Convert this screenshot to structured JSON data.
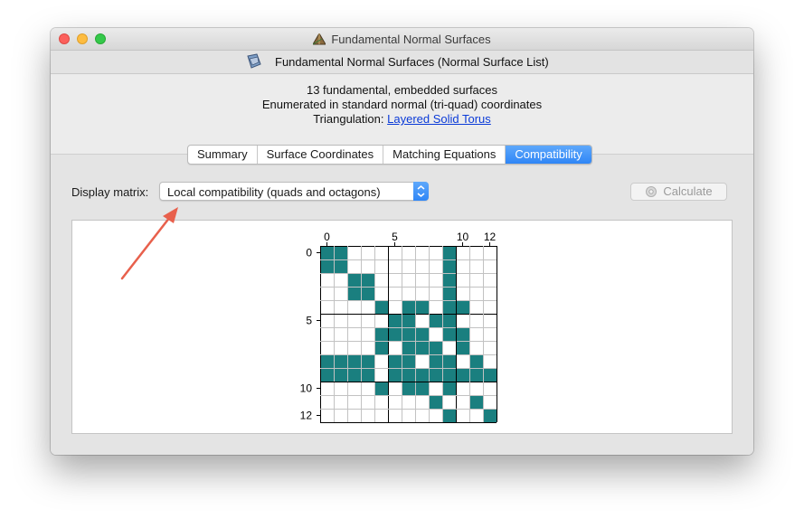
{
  "window": {
    "title": "Fundamental Normal Surfaces",
    "subtitle": "Fundamental Normal Surfaces (Normal Surface List)"
  },
  "info": {
    "line1": "13 fundamental, embedded surfaces",
    "line2": "Enumerated in standard normal (tri-quad) coordinates",
    "triangulation_prefix": "Triangulation:",
    "triangulation_link": "Layered Solid Torus"
  },
  "tabs": [
    {
      "label": "Summary",
      "active": false
    },
    {
      "label": "Surface Coordinates",
      "active": false
    },
    {
      "label": "Matching Equations",
      "active": false
    },
    {
      "label": "Compatibility",
      "active": true
    }
  ],
  "controls": {
    "display_label": "Display matrix:",
    "display_value": "Local compatibility (quads and octagons)",
    "calculate_label": "Calculate"
  },
  "matrix": {
    "size": 13,
    "fill_color": "#1a7f7f",
    "col_labels": [
      "0",
      "5",
      "10",
      "12"
    ],
    "row_labels": [
      "0",
      "5",
      "10",
      "12"
    ],
    "label_indices": [
      0,
      5,
      10,
      12
    ],
    "filled": [
      [
        0,
        0
      ],
      [
        0,
        1
      ],
      [
        0,
        9
      ],
      [
        1,
        0
      ],
      [
        1,
        1
      ],
      [
        1,
        9
      ],
      [
        2,
        2
      ],
      [
        2,
        3
      ],
      [
        2,
        9
      ],
      [
        3,
        2
      ],
      [
        3,
        3
      ],
      [
        3,
        9
      ],
      [
        4,
        4
      ],
      [
        4,
        6
      ],
      [
        4,
        7
      ],
      [
        4,
        9
      ],
      [
        4,
        10
      ],
      [
        5,
        5
      ],
      [
        5,
        6
      ],
      [
        5,
        8
      ],
      [
        5,
        9
      ],
      [
        6,
        4
      ],
      [
        6,
        5
      ],
      [
        6,
        6
      ],
      [
        6,
        7
      ],
      [
        6,
        9
      ],
      [
        6,
        10
      ],
      [
        7,
        4
      ],
      [
        7,
        6
      ],
      [
        7,
        7
      ],
      [
        7,
        8
      ],
      [
        7,
        10
      ],
      [
        8,
        0
      ],
      [
        8,
        1
      ],
      [
        8,
        2
      ],
      [
        8,
        3
      ],
      [
        8,
        5
      ],
      [
        8,
        6
      ],
      [
        8,
        8
      ],
      [
        8,
        9
      ],
      [
        8,
        11
      ],
      [
        9,
        0
      ],
      [
        9,
        1
      ],
      [
        9,
        2
      ],
      [
        9,
        3
      ],
      [
        9,
        5
      ],
      [
        9,
        6
      ],
      [
        9,
        7
      ],
      [
        9,
        8
      ],
      [
        9,
        9
      ],
      [
        9,
        10
      ],
      [
        9,
        11
      ],
      [
        9,
        12
      ],
      [
        10,
        4
      ],
      [
        10,
        6
      ],
      [
        10,
        7
      ],
      [
        10,
        9
      ],
      [
        11,
        8
      ],
      [
        11,
        11
      ],
      [
        12,
        9
      ],
      [
        12,
        12
      ]
    ]
  },
  "annotation": {
    "arrow_color": "#e8604c"
  }
}
